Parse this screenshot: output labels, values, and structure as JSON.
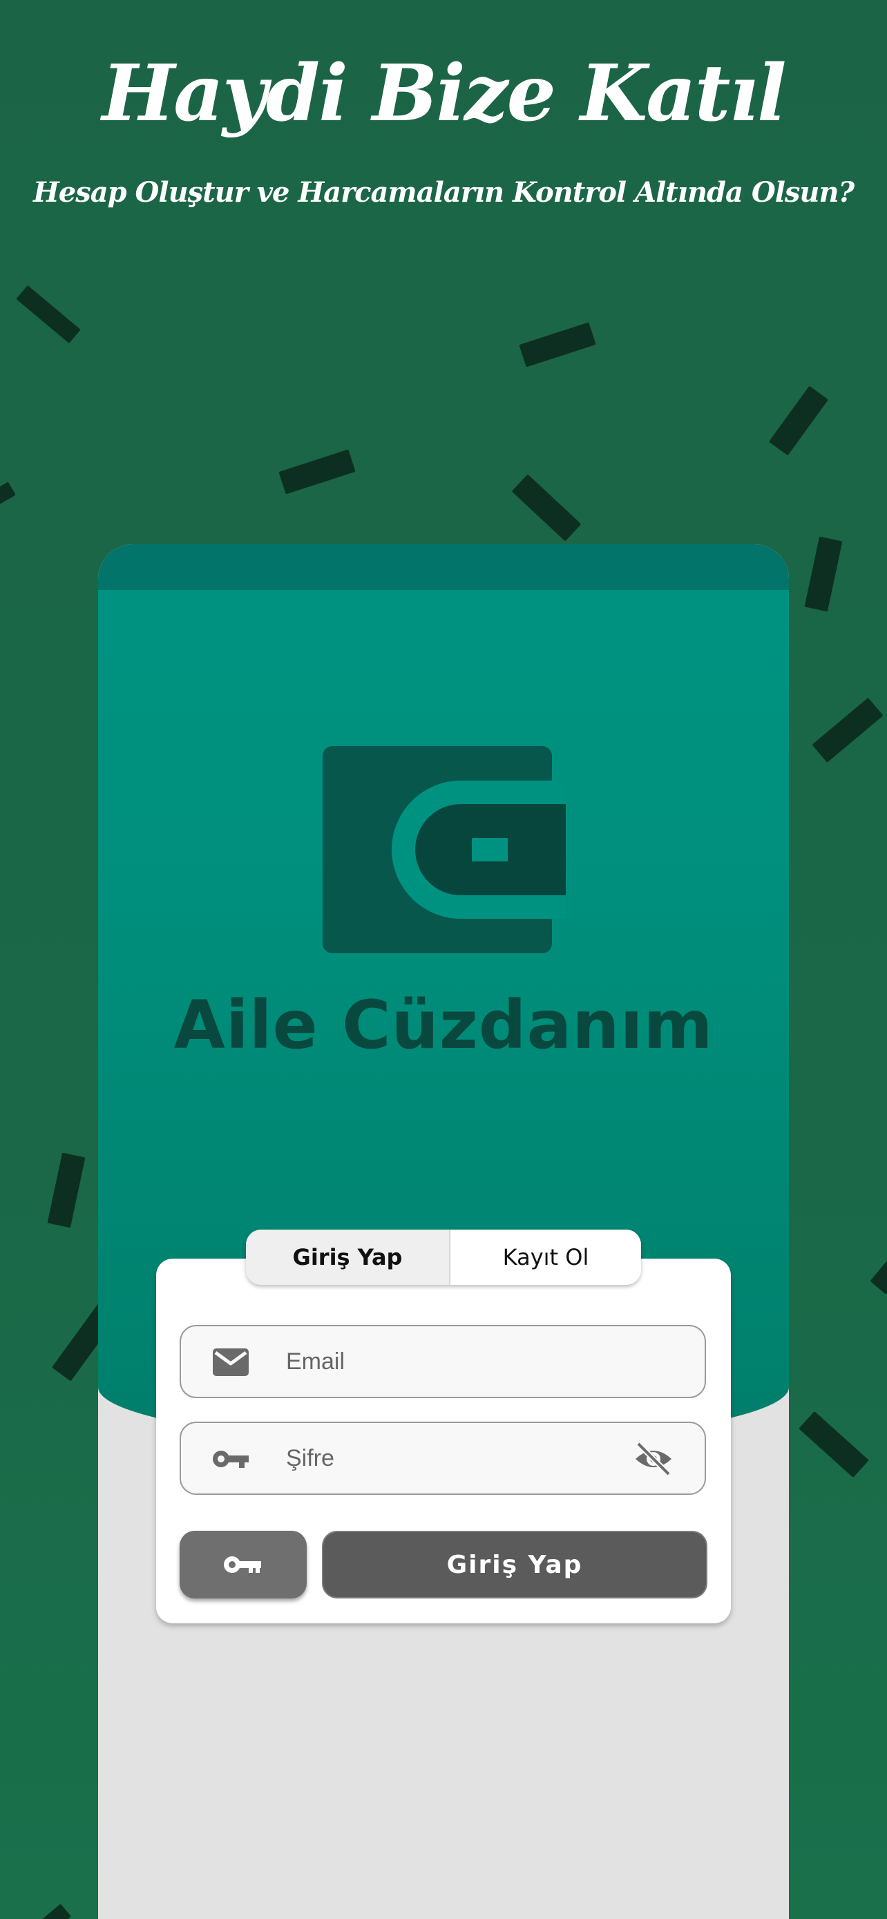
{
  "hero": {
    "title": "Haydi Bize Katıl",
    "subtitle": "Hesap Oluştur ve Harcamaların Kontrol Altında Olsun?"
  },
  "brand": {
    "name": "Aile Cüzdanım",
    "logo_icon": "wallet-icon"
  },
  "auth_tabs": {
    "login": "Giriş Yap",
    "register": "Kayıt Ol",
    "selected": "Giriş Yap"
  },
  "form": {
    "email_placeholder": "Email",
    "password_placeholder": "Şifre",
    "submit_label": "Giriş Yap",
    "icons": {
      "email": "mail-icon",
      "password": "key-icon",
      "visibility": "eye-off-icon",
      "key_button": "key-icon"
    }
  },
  "colors": {
    "background": "#1b6647",
    "card_accent": "#009381",
    "brand_text": "#08483e",
    "card_body": "#e2e2e2",
    "button": "#5b5b5b"
  }
}
